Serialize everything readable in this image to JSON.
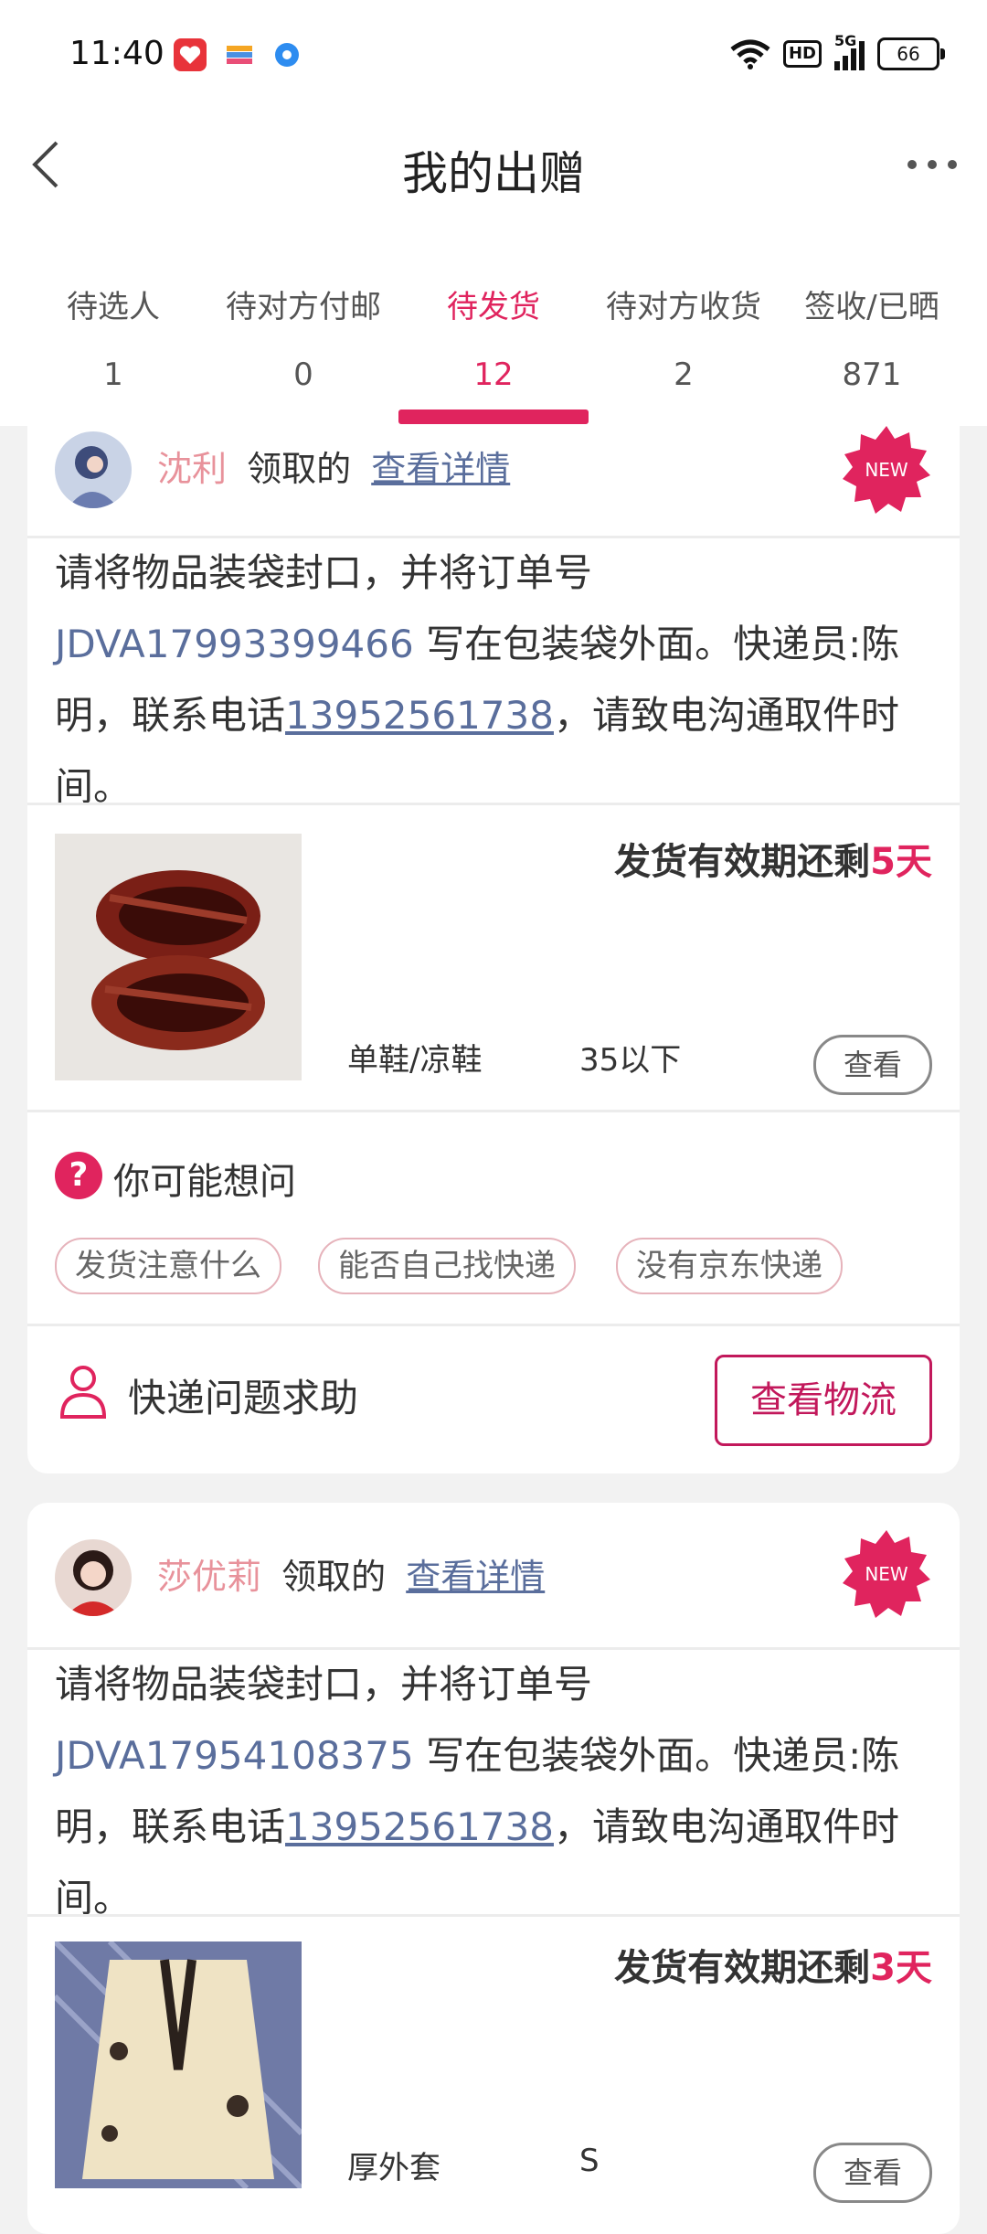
{
  "status_bar": {
    "time": "11:40",
    "app_icons": [
      "heart-app-icon",
      "card-app-icon",
      "circle-app-icon"
    ],
    "hd": "HD",
    "signal": "5G",
    "battery": "66"
  },
  "header": {
    "title": "我的出赠"
  },
  "tabs": [
    {
      "label": "待选人",
      "count": "1"
    },
    {
      "label": "待对方付邮",
      "count": "0"
    },
    {
      "label": "待发货",
      "count": "12"
    },
    {
      "label": "待对方收货",
      "count": "2"
    },
    {
      "label": "签收/已晒",
      "count": "871"
    }
  ],
  "active_tab": 2,
  "colors": {
    "accent": "#e0245e",
    "link": "#5a6e9c",
    "username": "#e8929b"
  },
  "orders": [
    {
      "username": "沈利",
      "claimed_text": "领取的",
      "detail_link": "查看详情",
      "badge": "NEW",
      "instruction_prefix": "请将物品装袋封口，并将订单号 ",
      "order_no": "JDVA17993399466",
      "instruction_middle": " 写在包装袋外面。快递员:陈明，联系电话",
      "phone": "13952561738",
      "instruction_suffix": "，请致电沟通取件时间。",
      "deadline_prefix": "发货有效期还剩",
      "deadline_days": "5天",
      "category": "单鞋/凉鞋",
      "size": "35以下",
      "view_label": "查看",
      "faq_title": "你可能想问",
      "faq_chips": [
        "发货注意什么",
        "能否自己找快递",
        "没有京东快递"
      ],
      "help_label": "快递问题求助",
      "logistics_label": "查看物流"
    },
    {
      "username": "莎优莉",
      "claimed_text": "领取的",
      "detail_link": "查看详情",
      "badge": "NEW",
      "instruction_prefix": "请将物品装袋封口，并将订单号 ",
      "order_no": "JDVA17954108375",
      "instruction_middle": " 写在包装袋外面。快递员:陈明，联系电话",
      "phone": "13952561738",
      "instruction_suffix": "，请致电沟通取件时间。",
      "deadline_prefix": "发货有效期还剩",
      "deadline_days": "3天",
      "category": "厚外套",
      "size": "S",
      "view_label": "查看"
    }
  ]
}
